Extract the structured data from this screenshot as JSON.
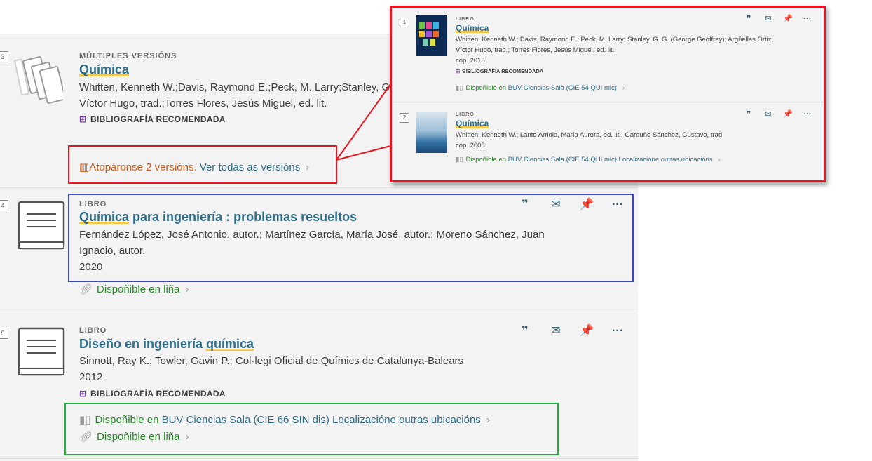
{
  "results": [
    {
      "number": "3",
      "type": "MÚLTIPLES VERSIÓNS",
      "title": "Química",
      "authors_line1": "Whitten, Kenneth W.;Davis, Raymond E.;Peck, M. Larry;Stanley, G",
      "authors_line2": "Víctor Hugo, trad.;Torres Flores, Jesús Miguel, ed. lit.",
      "recommended": "BIBLIOGRAFÍA RECOMENDADA",
      "versions_found": "Atopáronse 2 versións.",
      "versions_link": "Ver todas as versións"
    },
    {
      "number": "4",
      "type": "LIBRO",
      "title_hl": "Química",
      "title_rest": " para ingeniería : problemas resueltos",
      "authors_line1": "Fernández López, José Antonio, autor.; Martínez García, María José, autor.; Moreno Sánchez, Juan",
      "authors_line2": "Ignacio, autor.",
      "year": "2020",
      "online": "Dispoñible en liña"
    },
    {
      "number": "5",
      "type": "LIBRO",
      "title_pre": "Diseño en ingeniería ",
      "title_hl": "química",
      "authors_line1": "Sinnott, Ray K.; Towler, Gavin P.; Col·legi Oficial de Químics de Catalunya-Balears",
      "year": "2012",
      "recommended": "BIBLIOGRAFÍA RECOMENDADA",
      "avail_prefix": "Dispoñible en",
      "avail_link": "BUV Ciencias  Sala (CIE 66 SIN dis) Localizacióne outras ubicacións",
      "online": "Dispoñible en liña"
    }
  ],
  "popup": {
    "items": [
      {
        "number": "1",
        "type": "LIBRO",
        "title": "Química",
        "authors_line1": "Whitten, Kenneth W.; Davis, Raymond E.; Peck, M. Larry; Stanley, G. G. (George Geoffrey); Argüelles Ortiz,",
        "authors_line2": "Víctor Hugo, trad.; Torres Flores, Jesús Miguel, ed. lit.",
        "year": "cop. 2015",
        "recommended": "BIBLIOGRAFÍA RECOMENDADA",
        "avail_prefix": "Dispoñible en",
        "avail_link": "BUV Ciencias  Sala (CIE 54 QUI mic)"
      },
      {
        "number": "2",
        "type": "LIBRO",
        "title": "Química",
        "authors_line1": "Whitten, Kenneth W.; Lanto Arriola, María Aurora, ed. lit.; Garduño Sánchez, Gustavo, trad.",
        "year": "cop. 2008",
        "avail_prefix": "Dispoñible en",
        "avail_link": "BUV Ciencias  Sala (CIE 54 QUI mic) Localizacióne outras ubicacións"
      }
    ]
  },
  "icons": {
    "cite": "quote-icon",
    "email": "envelope-icon",
    "pin": "pin-icon",
    "more": "ellipsis-icon"
  },
  "colors": {
    "red_box": "#e8141e",
    "blue_box": "#3a46c2",
    "green_box": "#1fad3b",
    "title_link": "#2f6e8a",
    "available": "#2a8a2a",
    "versions_orange": "#d05a16",
    "highlight": "#f4c84a"
  }
}
